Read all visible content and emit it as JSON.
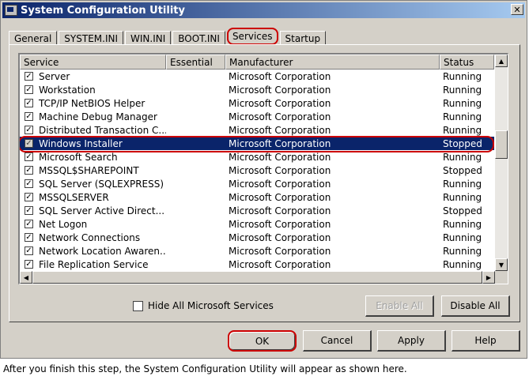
{
  "window": {
    "title": "System Configuration Utility",
    "close_glyph": "✕"
  },
  "tabs": [
    "General",
    "SYSTEM.INI",
    "WIN.INI",
    "BOOT.INI",
    "Services",
    "Startup"
  ],
  "columns": {
    "service": "Service",
    "essential": "Essential",
    "manufacturer": "Manufacturer",
    "status": "Status"
  },
  "services": [
    {
      "name": "Server",
      "essential": "",
      "manufacturer": "Microsoft Corporation",
      "status": "Running",
      "checked": true
    },
    {
      "name": "Workstation",
      "essential": "",
      "manufacturer": "Microsoft Corporation",
      "status": "Running",
      "checked": true
    },
    {
      "name": "TCP/IP NetBIOS Helper",
      "essential": "",
      "manufacturer": "Microsoft Corporation",
      "status": "Running",
      "checked": true
    },
    {
      "name": "Machine Debug Manager",
      "essential": "",
      "manufacturer": "Microsoft Corporation",
      "status": "Running",
      "checked": true
    },
    {
      "name": "Distributed Transaction C...",
      "essential": "",
      "manufacturer": "Microsoft Corporation",
      "status": "Running",
      "checked": true
    },
    {
      "name": "Windows Installer",
      "essential": "",
      "manufacturer": "Microsoft Corporation",
      "status": "Stopped",
      "checked": true,
      "selected": true
    },
    {
      "name": "Microsoft Search",
      "essential": "",
      "manufacturer": "Microsoft Corporation",
      "status": "Running",
      "checked": true
    },
    {
      "name": "MSSQL$SHAREPOINT",
      "essential": "",
      "manufacturer": "Microsoft Corporation",
      "status": "Stopped",
      "checked": true
    },
    {
      "name": "SQL Server (SQLEXPRESS)",
      "essential": "",
      "manufacturer": "Microsoft Corporation",
      "status": "Running",
      "checked": true
    },
    {
      "name": "MSSQLSERVER",
      "essential": "",
      "manufacturer": "Microsoft Corporation",
      "status": "Running",
      "checked": true
    },
    {
      "name": "SQL Server Active Direct...",
      "essential": "",
      "manufacturer": "Microsoft Corporation",
      "status": "Stopped",
      "checked": true
    },
    {
      "name": "Net Logon",
      "essential": "",
      "manufacturer": "Microsoft Corporation",
      "status": "Running",
      "checked": true
    },
    {
      "name": "Network Connections",
      "essential": "",
      "manufacturer": "Microsoft Corporation",
      "status": "Running",
      "checked": true
    },
    {
      "name": "Network Location Awaren...",
      "essential": "",
      "manufacturer": "Microsoft Corporation",
      "status": "Running",
      "checked": true
    },
    {
      "name": "File Replication Service",
      "essential": "",
      "manufacturer": "Microsoft Corporation",
      "status": "Running",
      "checked": true
    }
  ],
  "hide_ms": {
    "label": "Hide All Microsoft Services",
    "checked": false
  },
  "buttons": {
    "enable_all": "Enable All",
    "disable_all": "Disable All",
    "ok": "OK",
    "cancel": "Cancel",
    "apply": "Apply",
    "help": "Help"
  },
  "caption": "After you finish this step, the System Configuration Utility will appear as shown here.",
  "colors": {
    "title_bar": "#0a246a",
    "highlight": "#cc0000",
    "face": "#d4d0c8"
  }
}
